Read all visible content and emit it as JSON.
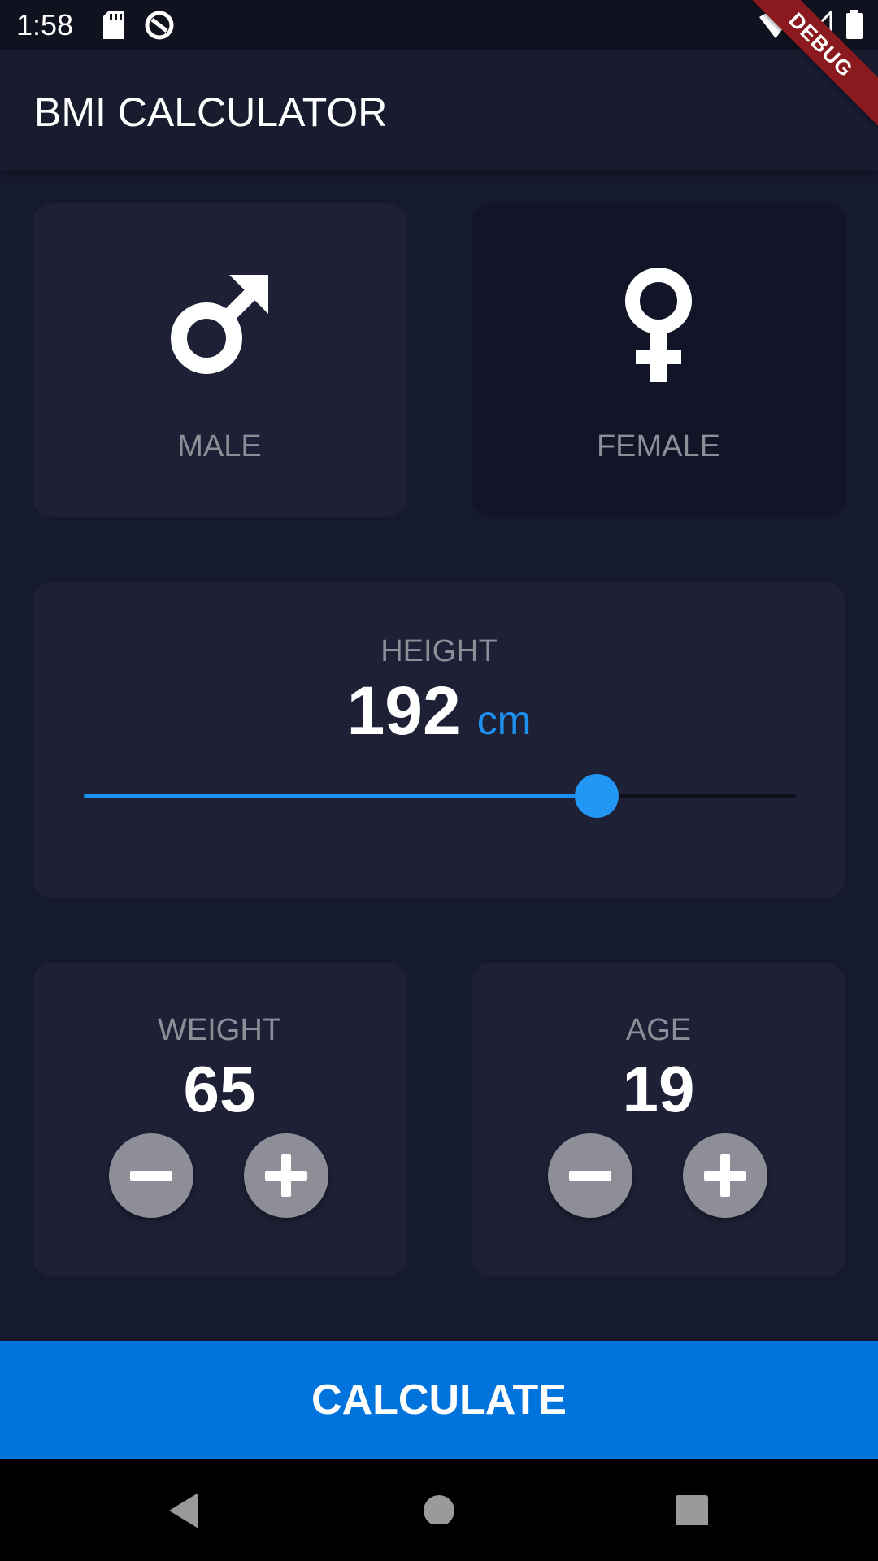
{
  "status_bar": {
    "time": "1:58"
  },
  "debug_banner": "DEBUG",
  "app_bar": {
    "title": "BMI CALCULATOR"
  },
  "gender": {
    "male_label": "MALE",
    "female_label": "FEMALE",
    "selected": "male"
  },
  "height": {
    "label": "HEIGHT",
    "value": "192",
    "unit": "cm",
    "slider_fraction": 0.72
  },
  "weight": {
    "label": "WEIGHT",
    "value": "65"
  },
  "age": {
    "label": "AGE",
    "value": "19"
  },
  "calculate_label": "CALCULATE",
  "colors": {
    "background": "#161a2e",
    "card": "#1e2036",
    "card_inactive": "#121428",
    "accent": "#1e90f0",
    "button": "#0073dd",
    "label": "#8d8e98"
  },
  "icons": {
    "male": "male-symbol-icon",
    "female": "female-symbol-icon",
    "minus": "minus-icon",
    "plus": "plus-icon"
  }
}
